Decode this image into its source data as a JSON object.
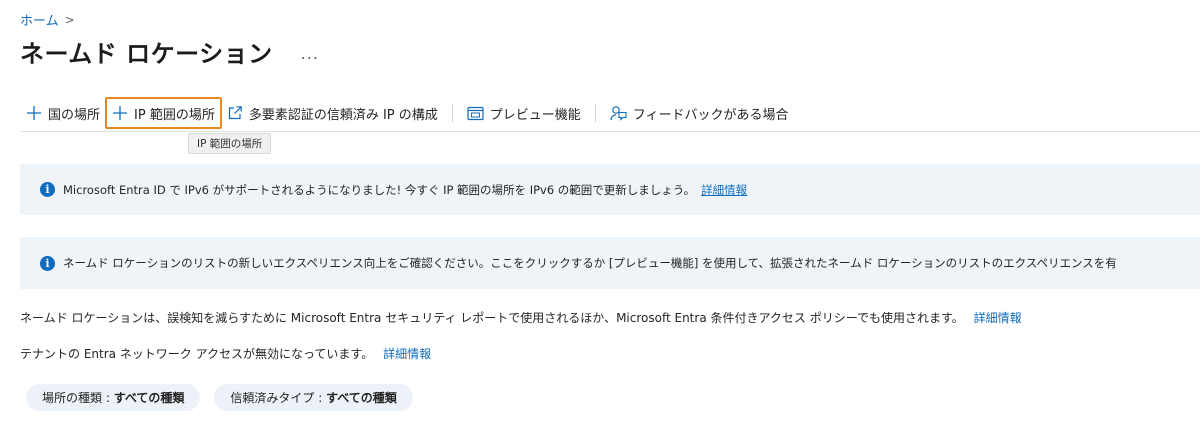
{
  "breadcrumb": {
    "home": "ホーム",
    "separator": ">"
  },
  "page": {
    "title": "ネームド ロケーション",
    "more": "..."
  },
  "toolbar": {
    "country_location": "国の場所",
    "ip_range_location": "IP 範囲の場所",
    "mfa_trusted_ips": "多要素認証の信頼済み IP の構成",
    "preview_features": "プレビュー機能",
    "feedback": "フィードバックがある場合"
  },
  "tooltip": {
    "text": "IP 範囲の場所"
  },
  "banner1": {
    "text": "Microsoft Entra ID で IPv6 がサポートされるようになりました! 今すぐ IP 範囲の場所を IPv6 の範囲で更新しましょう。",
    "link": "詳細情報"
  },
  "banner2": {
    "text": "ネームド ロケーションのリストの新しいエクスペリエンス向上をご確認ください。ここをクリックするか [プレビュー機能] を使用して、拡張されたネームド ロケーションのリストのエクスペリエンスを有"
  },
  "description": {
    "text": "ネームド ロケーションは、誤検知を減らすために Microsoft Entra セキュリティ レポートで使用されるほか、Microsoft Entra 条件付きアクセス ポリシーでも使用されます。",
    "link": "詳細情報"
  },
  "network_access": {
    "text": "テナントの Entra ネットワーク アクセスが無効になっています。",
    "link": "詳細情報"
  },
  "filters": [
    {
      "label": "場所の種類 : ",
      "value": "すべての種類"
    },
    {
      "label": "信頼済みタイプ : ",
      "value": "すべての種類"
    }
  ],
  "colors": {
    "accent": "#0f6cbd",
    "focus_outline": "#e8891f",
    "banner_bg": "#eff4f9",
    "pill_bg": "#edf2f8"
  },
  "icons": [
    "plus-icon",
    "plus-icon",
    "external-link-icon",
    "preview-icon",
    "feedback-icon",
    "info-icon"
  ]
}
